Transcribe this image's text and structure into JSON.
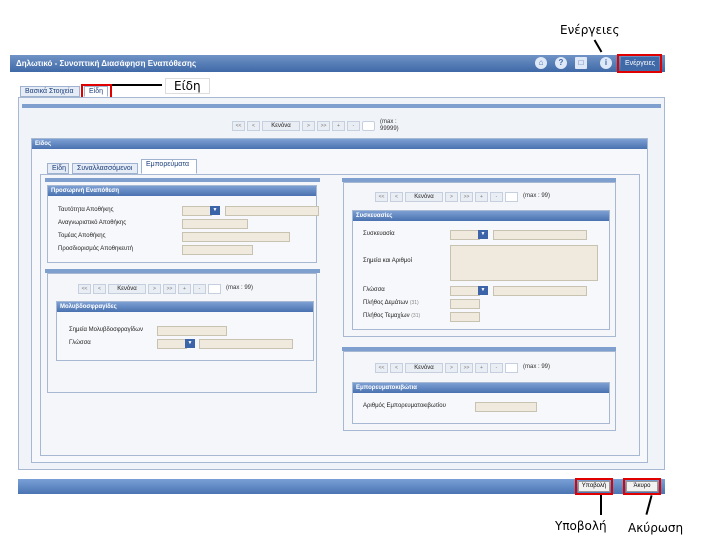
{
  "titlebar": {
    "title": "Δηλωτικό - Συνοπτική Διασάφηση Εναπόθεσης",
    "actions_button": "Ενέργειες"
  },
  "callouts": {
    "actions": "Ενέργειες",
    "items": "Είδη",
    "submit": "Υποβολή",
    "cancel": "Ακύρωση"
  },
  "tabs": [
    "Βασικά Στοιχεία",
    "Είδη"
  ],
  "pager": {
    "first": "<<",
    "prev": "<",
    "caption": "Κενόνα",
    "next": ">",
    "last": ">>",
    "add": "+",
    "remove": "-",
    "max_main": "(max : 99999)",
    "max": "(max : 99)"
  },
  "items_section": {
    "header": "Είδος",
    "subtabs": [
      "Είδη",
      "Συναλλασσόμενοι",
      "Εμπορεύματα"
    ]
  },
  "temp_storage": {
    "header": "Προσωρινή Εναπόθεση",
    "labels": [
      "Ταυτότητα Αποθήκης",
      "Αναγνωριστικό Αποθήκης",
      "Τομέας Αποθήκης",
      "Προσδιορισμός Αποθηκευτή"
    ]
  },
  "seals": {
    "header": "Μολυβδοσφραγίδες",
    "labels": [
      "Σημεία Μολυβδοσφραγίδων",
      "Γλώσσα"
    ]
  },
  "packages": {
    "header": "Συσκευασίες",
    "labels": [
      "Συσκευασία",
      "Σημεία και Αριθμοί",
      "Γλώσσα",
      "Πλήθος Δεμάτων",
      "Πλήθος Τεμαχίων"
    ],
    "counter": "(31)"
  },
  "containers": {
    "header": "Εμπορευματοκιβώτια",
    "labels": [
      "Αριθμός Εμπορευματοκιβωτίου"
    ]
  },
  "buttons": {
    "submit": "Υποβολή",
    "cancel": "Άκυρο"
  },
  "colors": {
    "header": "#4a72b0",
    "highlight": "#e00000",
    "field_bg": "#efeadd"
  }
}
